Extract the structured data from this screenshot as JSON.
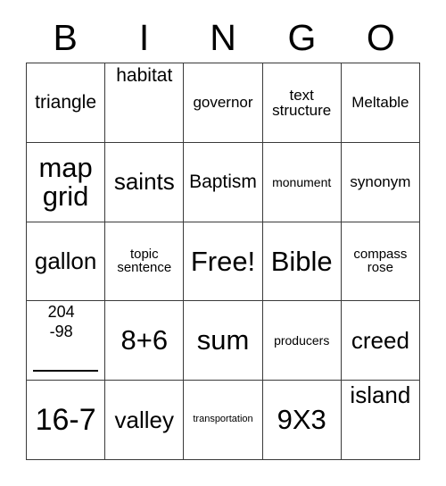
{
  "card": {
    "header_letters": [
      "B",
      "I",
      "N",
      "G",
      "O"
    ],
    "rows": [
      [
        {
          "text": "triangle"
        },
        {
          "text": "habitat"
        },
        {
          "text": "governor"
        },
        {
          "text": "text structure"
        },
        {
          "text": "Meltable"
        }
      ],
      [
        {
          "text": "map grid"
        },
        {
          "text": "saints"
        },
        {
          "text": "Baptism"
        },
        {
          "text": "monument"
        },
        {
          "text": "synonym"
        }
      ],
      [
        {
          "text": "gallon"
        },
        {
          "text": "topic sentence"
        },
        {
          "text": "Free!"
        },
        {
          "text": "Bible"
        },
        {
          "text": "compass rose"
        }
      ],
      [
        {
          "text": "204 -98",
          "minuend": "204",
          "subtrahend": "-98"
        },
        {
          "text": "8+6"
        },
        {
          "text": "sum"
        },
        {
          "text": "producers"
        },
        {
          "text": "creed"
        }
      ],
      [
        {
          "text": "16-7"
        },
        {
          "text": "valley"
        },
        {
          "text": "transportation"
        },
        {
          "text": "9X3"
        },
        {
          "text": "island"
        }
      ]
    ]
  }
}
